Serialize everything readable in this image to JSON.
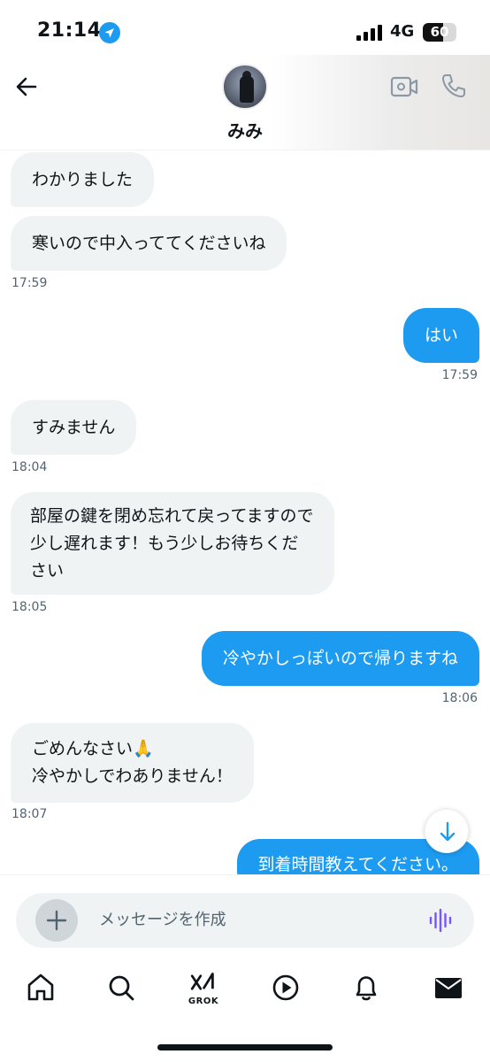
{
  "status_bar": {
    "time": "21:14",
    "network": "4G",
    "battery": "60",
    "battery_level": 0.6,
    "icons": [
      "location-arrow-icon",
      "cellular-signal-icon",
      "battery-icon"
    ]
  },
  "header": {
    "contact_name": "みみ",
    "icons": [
      "back-arrow-icon",
      "video-camera-icon",
      "phone-icon"
    ]
  },
  "messages": [
    {
      "side": "in",
      "text": "わかりました"
    },
    {
      "side": "in",
      "text": "寒いので中入っててくださいね",
      "time": "17:59"
    },
    {
      "side": "out",
      "text": "はい",
      "time": "17:59"
    },
    {
      "side": "in",
      "text": "すみません",
      "time": "18:04"
    },
    {
      "side": "in",
      "text": "部屋の鍵を閉め忘れて戻ってますので少し遅れます！もう少しお待ちください",
      "time": "18:05"
    },
    {
      "side": "out",
      "text": "冷やかしっぽいので帰りますね",
      "time": "18:06"
    },
    {
      "side": "in",
      "text": "ごめんなさい🙏 冷やかしでわありません！",
      "line1": "ごめんなさい🙏",
      "line2": "冷やかしでわありません！",
      "time": "18:07"
    },
    {
      "side": "out",
      "text": "到着時間教えてください。"
    }
  ],
  "composer": {
    "placeholder": "メッセージを作成",
    "icons": [
      "plus-icon",
      "voice-waveform-icon"
    ]
  },
  "bottom_nav": {
    "grok_label": "GROK",
    "items": [
      "home-icon",
      "search-icon",
      "grok-icon",
      "play-icon",
      "bell-icon",
      "mail-icon"
    ]
  },
  "colors": {
    "accent": "#1d9bf0",
    "incoming_bubble": "#eff3f4",
    "timestamp": "#536471",
    "voice_icon": "#7856ff"
  }
}
